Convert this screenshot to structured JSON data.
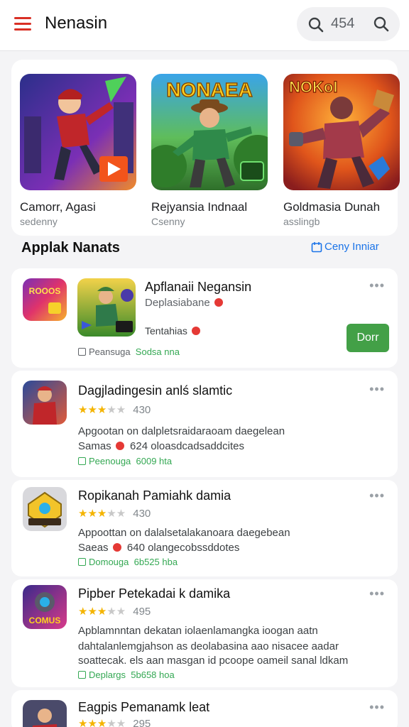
{
  "header": {
    "title": "Nenasin",
    "search_value": "454"
  },
  "featured": [
    {
      "title": "Camorr, Agasi",
      "subtitle": "sedenny"
    },
    {
      "title": "Rejyansia Indnaal",
      "subtitle": "Csenny"
    },
    {
      "title": "Goldmasia Dunah",
      "subtitle": "asslingb"
    }
  ],
  "featured_art_text": [
    "NONAEA",
    "NOKoI"
  ],
  "section": {
    "title": "Applak Nanats",
    "link": "Ceny Inniar"
  },
  "apps": [
    {
      "name": "Apflanaii Negansin",
      "subtitle": "Deplasiabane",
      "extra": "Tentahias",
      "tag_grey": "Peansuga",
      "tag_green": "Sodsa nna",
      "button": "Dorr"
    },
    {
      "name": "Dagjladingesin anlś slamtic",
      "rating": "430",
      "desc1": "Apgootan on dalpletsraidaraoam daegelean",
      "desc2": "Samas",
      "desc2b": "624 oloasdcadsaddcites",
      "tag_grey": "Peenouga",
      "tag_green": "6009 hta"
    },
    {
      "name": "Ropikanah Pamiahk damia",
      "rating": "430",
      "desc1": "Appoottan on dalalsetalakanoara daegebean",
      "desc2": "Saeas",
      "desc2b": "640 olangecobssddotes",
      "tag_grey": "Domouga",
      "tag_green": "6b525 hba"
    },
    {
      "name": "Pipber Petekadai k damika",
      "rating": "495",
      "desc1": "Apblamnntan dekatan iolaenlamangka ioogan aatn",
      "desc2": "dahtalanlemgjahson as deolabasina aao nisacee aadar",
      "desc3": "soattecak. els aan masgan id pcoope oameil sanal ldkam",
      "tag_grey": "Deplargs",
      "tag_green": "5b658 hoa"
    },
    {
      "name": "Eagpis Pemanamk leat",
      "rating": "295"
    }
  ],
  "icon_badges": [
    "ROOOS",
    "COMUS"
  ]
}
